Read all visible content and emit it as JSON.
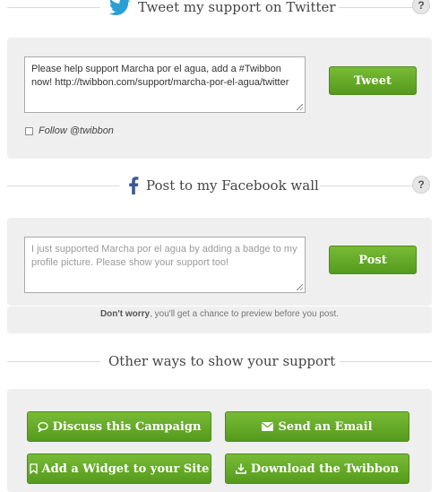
{
  "twitter": {
    "title": "Tweet my support on Twitter",
    "icon": "twitter-bird-icon",
    "help": "?",
    "message": "Please help support Marcha por el agua, add a #Twibbon now! http://twibbon.com/support/marcha-por-el-agua/twitter",
    "button": "Tweet",
    "follow_label": "Follow @twibbon"
  },
  "facebook": {
    "title": "Post to my Facebook wall",
    "icon": "facebook-f-icon",
    "help": "?",
    "placeholder": "I just supported Marcha por el agua by adding a badge to my profile picture. Please show your support too!",
    "button": "Post",
    "note_bold": "Don't worry",
    "note_rest": ", you'll get a chance to preview before you post."
  },
  "other": {
    "title": "Other ways to show your support",
    "buttons": [
      {
        "label": "Discuss this Campaign",
        "icon": "comment-icon"
      },
      {
        "label": "Send an Email",
        "icon": "envelope-icon"
      },
      {
        "label": "Add a Widget to your Site",
        "icon": "bookmark-icon"
      },
      {
        "label": "Download the Twibbon",
        "icon": "download-icon"
      }
    ]
  },
  "colors": {
    "button_green": "#64a829",
    "twitter_blue": "#2a9fd6",
    "facebook_blue": "#3b5998",
    "panel_bg": "#efefef"
  }
}
